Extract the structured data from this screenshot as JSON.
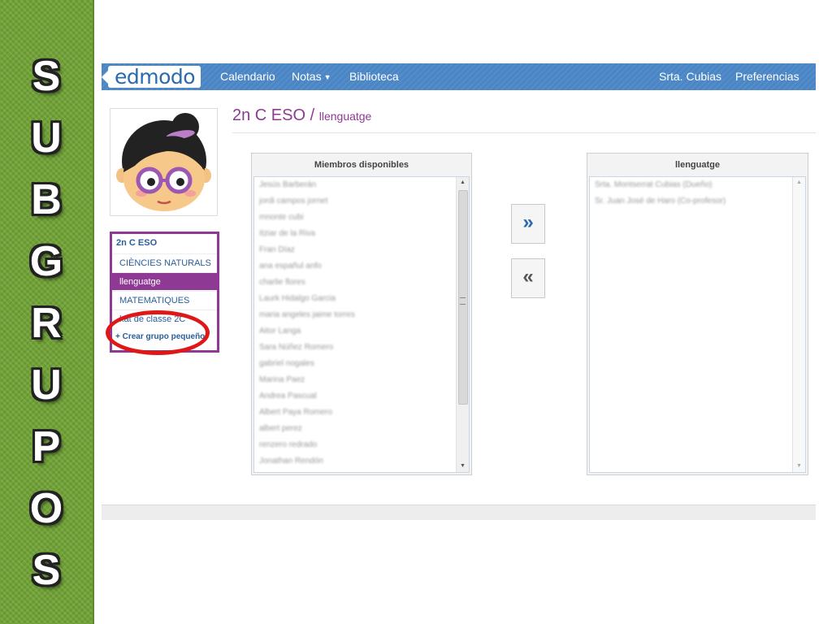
{
  "slide": {
    "title_letters": [
      "S",
      "U",
      "B",
      "G",
      "R",
      "U",
      "P",
      "O",
      "S"
    ]
  },
  "navbar": {
    "logo_text": "edmodo",
    "links": [
      "Calendario",
      "Notas",
      "Biblioteca"
    ],
    "user": "Srta. Cubias",
    "preferences": "Preferencias",
    "colors": {
      "bar": "#4a86c5",
      "accent": "#8e3a94"
    }
  },
  "sidebar": {
    "group_name": "2n C ESO",
    "items": [
      "CIÈNCIES NATURALS",
      "llenguatge",
      "MATEMATIQUES",
      "kat de classe 2C"
    ],
    "active_item": "llenguatge",
    "create_label": "+ Crear grupo pequeño"
  },
  "header": {
    "group": "2n C ESO",
    "separator": "/",
    "subgroup": "llenguatge"
  },
  "available_panel": {
    "title": "Miembros disponibles",
    "members": [
      "Jesús Barberán",
      "jordi campos jornet",
      "mnonte cubi",
      "Itziar de la Riva",
      "Fran Díaz",
      "ana españul anfo",
      "charlie flores",
      "Laurk Hidalgo Garcia",
      "maria angeles jaime torres",
      "Aitor Langa",
      "Sara Núñez Romero",
      "gabriel nogales",
      "Marina Paez",
      "Andrea Pascual",
      "Albert Paya Romero",
      "albert perez",
      "renzero redrado",
      "Jonathan Rendón"
    ]
  },
  "move_buttons": {
    "add": "»",
    "remove": "«"
  },
  "subgroup_panel": {
    "title": "llenguatge",
    "members": [
      "Srta. Montserrat Cubias (Dueño)",
      "Sr. Juan José de Haro (Co-profesor)"
    ]
  }
}
